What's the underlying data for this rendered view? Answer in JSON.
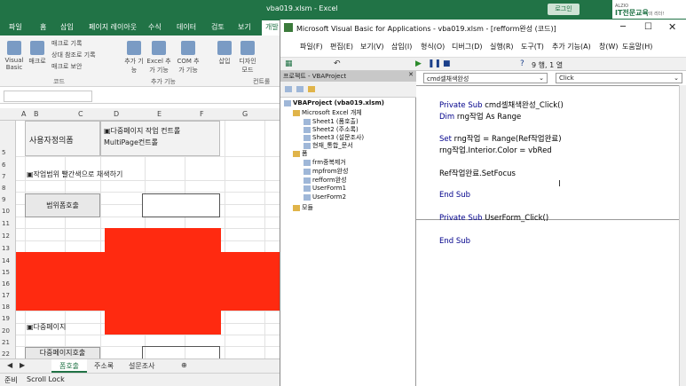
{
  "excel": {
    "title": "vba019.xlsm - Excel",
    "login": "로그인",
    "brand": {
      "small": "ALZIO",
      "text": "IT전문교육",
      "suffix": "의 리더!"
    },
    "tabs": [
      "파일",
      "홈",
      "삽입",
      "페이지 레이아웃",
      "수식",
      "데이터",
      "검토",
      "보기",
      "개발"
    ],
    "ribbon": {
      "visual_basic": "Visual Basic",
      "macro": "매크로",
      "record_macro": "매크로 기록",
      "relative_ref": "상대 참조로 기록",
      "macro_security": "매크로 보안",
      "addin": "추가 기능",
      "excel_addin": "Excel 추가 기능",
      "com_addin": "COM 추가 기능",
      "insert": "삽입",
      "design_mode": "디자인 모드",
      "group_code": "코드",
      "group_addin": "추가 기능",
      "group_controls": "컨트롤"
    },
    "columns": [
      "A",
      "B",
      "C",
      "D",
      "E",
      "F",
      "G"
    ],
    "rows": [
      "5",
      "6",
      "7",
      "8",
      "9",
      "10",
      "11",
      "12",
      "13",
      "14",
      "15",
      "16",
      "17",
      "18",
      "19",
      "20",
      "21",
      "22"
    ],
    "cells": {
      "b5": "사용자정의폼",
      "e5_line1": "▣다중페이지 작업 컨트롤",
      "e5_line2": "MultiPage컨트롤",
      "row7": "▣작업범위 빨간색으로 채색하기",
      "btn10": "범위폼호출",
      "row20": "▣다중페이지",
      "row22": "다중페이지호출"
    },
    "sheet_tabs": [
      "폼호출",
      "주소록",
      "설문조사"
    ],
    "status": {
      "ready": "준비",
      "scroll_lock": "Scroll Lock"
    }
  },
  "vbe": {
    "title": "Microsoft Visual Basic for Applications - vba019.xlsm - [refform완성 (코드)]",
    "menu": [
      "파일(F)",
      "편집(E)",
      "보기(V)",
      "삽입(I)",
      "형식(O)",
      "디버그(D)",
      "실행(R)",
      "도구(T)",
      "추가 기능(A)",
      "창(W)",
      "도움말(H)"
    ],
    "toolbar_position": "9 행, 1 열",
    "project_title": "프로젝트 - VBAProject",
    "tree": [
      "VBAProject (vba019.xlsm)",
      "Microsoft Excel 개체",
      "Sheet1 (폼호출)",
      "Sheet2 (주소록)",
      "Sheet3 (설문조사)",
      "현재_통합_문서",
      "폼",
      "frm중복제거",
      "mpfrom완성",
      "refform완성",
      "UserForm1",
      "UserForm2",
      "모듈"
    ],
    "object_combo": "cmd셀채색완성",
    "proc_combo": "Click",
    "code": [
      {
        "kw": "Private Sub ",
        "rest": "cmd셀채색완성_Click()"
      },
      {
        "kw": "Dim ",
        "rest": "rng작업 As Range"
      },
      {
        "kw": "Set ",
        "rest": "rng작업 = Range(Ref작업완료)"
      },
      {
        "kw": "",
        "rest": "rng작업.Interior.Color = vbRed"
      },
      {
        "kw": "",
        "rest": "Ref작업완료.SetFocus"
      },
      {
        "kw": "End Sub",
        "rest": ""
      },
      {
        "kw": "Private Sub ",
        "rest": "UserForm_Click()"
      },
      {
        "kw": "End Sub",
        "rest": ""
      }
    ]
  },
  "colors": {
    "excel_green": "#217346",
    "red_fill": "#ff2a10",
    "code_keyword": "#00008b"
  }
}
